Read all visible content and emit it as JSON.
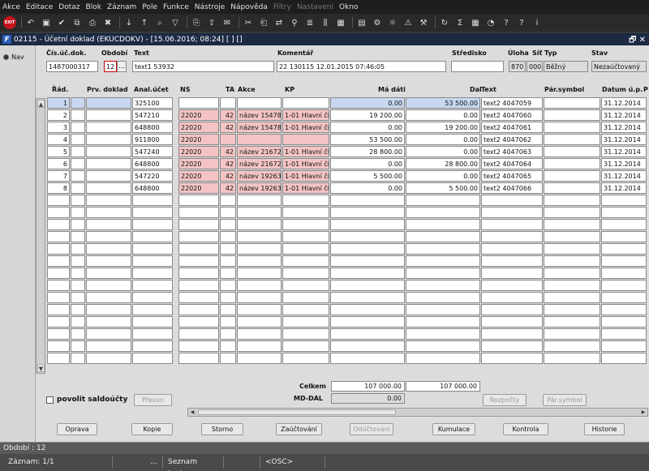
{
  "menu": [
    "Akce",
    "Editace",
    "Dotaz",
    "Blok",
    "Záznam",
    "Pole",
    "Funkce",
    "Nástroje",
    "Nápověda",
    "Filtry",
    "Nastavení",
    "Okno"
  ],
  "menu_disabled": [
    "Filtry",
    "Nastavení"
  ],
  "toolbar": {
    "exit_label": "EXIT",
    "icons": [
      "undo-icon",
      "save-icon",
      "commit-icon",
      "copy-icon",
      "print-icon",
      "delete-icon",
      "sort-asc-icon",
      "sort-desc-icon",
      "search-icon",
      "filter-icon",
      "print-preview-icon",
      "export-icon",
      "mail-icon",
      "cut-icon",
      "paste-icon",
      "replace-icon",
      "find-icon",
      "list-icon",
      "columns-icon",
      "calculator-icon",
      "disk-icon",
      "settings-icon",
      "sun-icon",
      "warning-icon",
      "tools-icon",
      "refresh-icon",
      "sum-icon",
      "calendar-icon",
      "dial-icon",
      "help-icon",
      "question-icon",
      "info-icon"
    ]
  },
  "window": {
    "title": "02115 - Účetní doklad (EKUCDOKV) - [15.06.2016; 08:24] [ ] []",
    "controls": "🗗 ✕"
  },
  "nav": {
    "label": "Nav"
  },
  "header": {
    "doc_no_label": "Čís.úč.dok.",
    "doc_no_value": "1487000317",
    "period_label": "Období",
    "period_value": "12",
    "period_btn": "…",
    "text_label": "Text",
    "text_value": "text1 53932",
    "comment_label": "Komentář",
    "comment_value": "22 130115 12.01.2015 07:46:05",
    "center_label": "Středisko",
    "center_value": "",
    "task_label": "Úloha",
    "task_value": "870",
    "net_label": "Síť",
    "net_value": "000",
    "type_label": "Typ",
    "type_value": "Běžný",
    "state_label": "Stav",
    "state_value": "Nezaúčtovaný"
  },
  "grid": {
    "headers": [
      "Řád.",
      "Prv. doklad",
      "Anal.účet",
      "NS",
      "TA",
      "Akce",
      "KP",
      "Má dáti",
      "Dal",
      "Text",
      "Pár.symbol",
      "Datum ú.p.",
      "P"
    ],
    "rows": [
      {
        "n": "1",
        "prv": "",
        "ucet": "325100",
        "ns": "",
        "ta": "",
        "akce": "",
        "kp": "",
        "md": "0.00",
        "dal": "53 500.00",
        "text": "text2 4047059",
        "par": "",
        "dat": "31.12.2014"
      },
      {
        "n": "2",
        "prv": "",
        "ucet": "547210",
        "ns": "22020",
        "ta": "42",
        "akce": "název 15478",
        "kp": "1-01 Hlavní či",
        "md": "19 200.00",
        "dal": "0.00",
        "text": "text2 4047060",
        "par": "",
        "dat": "31.12.2014"
      },
      {
        "n": "3",
        "prv": "",
        "ucet": "648800",
        "ns": "22020",
        "ta": "42",
        "akce": "název 15478",
        "kp": "1-01 Hlavní či",
        "md": "0.00",
        "dal": "19 200.00",
        "text": "text2 4047061",
        "par": "",
        "dat": "31.12.2014"
      },
      {
        "n": "4",
        "prv": "",
        "ucet": "911800",
        "ns": "22020",
        "ta": "",
        "akce": "",
        "kp": "",
        "md": "53 500.00",
        "dal": "0.00",
        "text": "text2 4047062",
        "par": "",
        "dat": "31.12.2014"
      },
      {
        "n": "5",
        "prv": "",
        "ucet": "547240",
        "ns": "22020",
        "ta": "42",
        "akce": "název 21672",
        "kp": "1-01 Hlavní či",
        "md": "28 800.00",
        "dal": "0.00",
        "text": "text2 4047063",
        "par": "",
        "dat": "31.12.2014"
      },
      {
        "n": "6",
        "prv": "",
        "ucet": "648800",
        "ns": "22020",
        "ta": "42",
        "akce": "název 21672",
        "kp": "1-01 Hlavní či",
        "md": "0.00",
        "dal": "28 800.00",
        "text": "text2 4047064",
        "par": "",
        "dat": "31.12.2014"
      },
      {
        "n": "7",
        "prv": "",
        "ucet": "547220",
        "ns": "22020",
        "ta": "42",
        "akce": "název 19263",
        "kp": "1-01 Hlavní či",
        "md": "5 500.00",
        "dal": "0.00",
        "text": "text2 4047065",
        "par": "",
        "dat": "31.12.2014"
      },
      {
        "n": "8",
        "prv": "",
        "ucet": "648800",
        "ns": "22020",
        "ta": "42",
        "akce": "název 19263",
        "kp": "1-01 Hlavní či",
        "md": "0.00",
        "dal": "5 500.00",
        "text": "text2 4047066",
        "par": "",
        "dat": "31.12.2014"
      }
    ]
  },
  "totals": {
    "celkem_label": "Celkem",
    "celkem_md": "107 000.00",
    "celkem_dal": "107 000.00",
    "mddal_label": "MD-DAL",
    "mddal_value": "0.00"
  },
  "options": {
    "saldo_label": "povolit saldoúčty",
    "presun_label": "Přesun",
    "rozpocty_label": "Rozpočty",
    "parsymbol_label": "Pár.symbol"
  },
  "buttons": {
    "oprava": "Oprava",
    "kopie": "Kopie",
    "storno": "Storno",
    "zauctovani": "Zaúčtování",
    "oductovani": "Odúčtování",
    "kumulace": "Kumulace",
    "kontrola": "Kontrola",
    "historie": "Historie"
  },
  "status": {
    "line1": "Období : 12",
    "zaznam": "Záznam: 1/1",
    "dots": "...",
    "seznam": "Seznam hodn...",
    "osc": "<OSC>"
  }
}
